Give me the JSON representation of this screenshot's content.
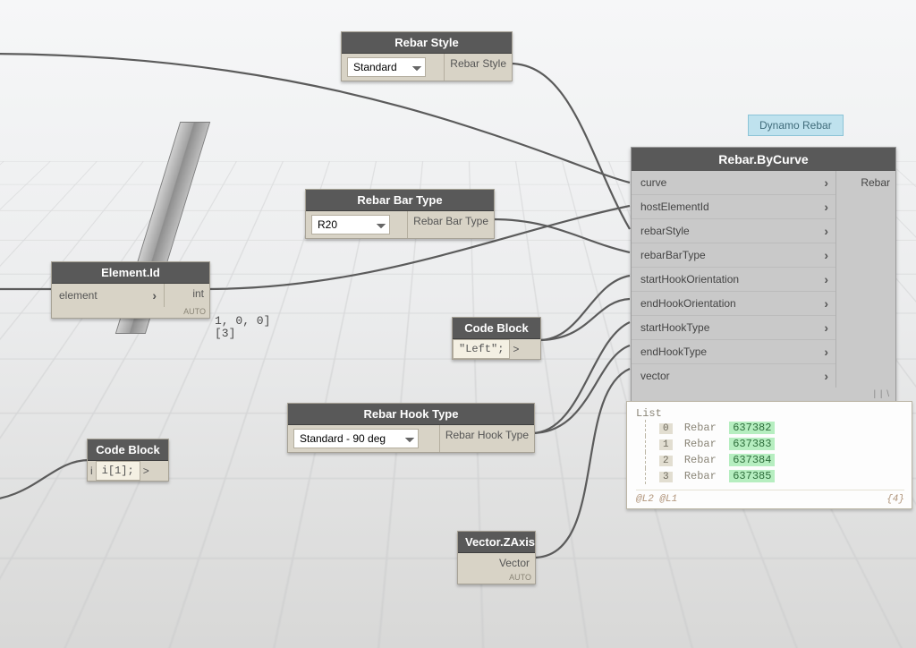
{
  "chip": {
    "label": "Dynamo Rebar"
  },
  "nodes": {
    "rebar_style": {
      "title": "Rebar Style",
      "value": "Standard",
      "out": "Rebar Style"
    },
    "rebar_bar_type": {
      "title": "Rebar Bar Type",
      "value": "R20",
      "out": "Rebar Bar Type"
    },
    "rebar_hook_type": {
      "title": "Rebar Hook Type",
      "value": "Standard - 90 deg",
      "out": "Rebar Hook Type"
    },
    "vector_zaxis": {
      "title": "Vector.ZAxis",
      "out": "Vector",
      "auto": "AUTO"
    },
    "element_id": {
      "title": "Element.Id",
      "in": "element",
      "out": "int",
      "auto": "AUTO"
    },
    "code_block_i": {
      "title": "Code Block",
      "code": "i[1];",
      "ports": [
        "i",
        ">"
      ]
    },
    "code_block_left": {
      "title": "Code Block",
      "code": "\"Left\";",
      "ports": [
        ">"
      ]
    }
  },
  "bignode": {
    "title": "Rebar.ByCurve",
    "out": "Rebar",
    "inputs": [
      "curve",
      "hostElementId",
      "rebarStyle",
      "rebarBarType",
      "startHookOrientation",
      "endHookOrientation",
      "startHookType",
      "endHookType",
      "vector"
    ],
    "lacing": "| | \\"
  },
  "preview": {
    "header": "List",
    "rows": [
      {
        "idx": "0",
        "type": "Rebar",
        "value": "637382"
      },
      {
        "idx": "1",
        "type": "Rebar",
        "value": "637383"
      },
      {
        "idx": "2",
        "type": "Rebar",
        "value": "637384"
      },
      {
        "idx": "3",
        "type": "Rebar",
        "value": "637385"
      }
    ],
    "levels": "@L2 @L1",
    "count": "{4}"
  },
  "floor_overlay": {
    "line1": "1, 0, 0]",
    "line2": "[3]"
  },
  "chart_data": {
    "type": "diagram",
    "title": "Dynamo visual-programming graph — Rebar.ByCurve",
    "nodes": [
      {
        "id": "rebar_style",
        "label": "Rebar Style",
        "outputs": [
          "Rebar Style"
        ],
        "value": "Standard"
      },
      {
        "id": "rebar_bar_type",
        "label": "Rebar Bar Type",
        "outputs": [
          "Rebar Bar Type"
        ],
        "value": "R20"
      },
      {
        "id": "rebar_hook_type",
        "label": "Rebar Hook Type",
        "outputs": [
          "Rebar Hook Type"
        ],
        "value": "Standard - 90 deg"
      },
      {
        "id": "element_id",
        "label": "Element.Id",
        "inputs": [
          "element"
        ],
        "outputs": [
          "int"
        ]
      },
      {
        "id": "code_block_i",
        "label": "Code Block",
        "code": "i[1];"
      },
      {
        "id": "code_block_left",
        "label": "Code Block",
        "code": "\"Left\";"
      },
      {
        "id": "vector_zaxis",
        "label": "Vector.ZAxis",
        "outputs": [
          "Vector"
        ]
      },
      {
        "id": "rebar_by_curve",
        "label": "Rebar.ByCurve",
        "inputs": [
          "curve",
          "hostElementId",
          "rebarStyle",
          "rebarBarType",
          "startHookOrientation",
          "endHookOrientation",
          "startHookType",
          "endHookType",
          "vector"
        ],
        "outputs": [
          "Rebar"
        ]
      }
    ],
    "edges": [
      {
        "from": "rebar_style",
        "to": "rebar_by_curve",
        "to_port": "rebarStyle"
      },
      {
        "from": "rebar_bar_type",
        "to": "rebar_by_curve",
        "to_port": "rebarBarType"
      },
      {
        "from": "element_id",
        "to": "rebar_by_curve",
        "to_port": "hostElementId"
      },
      {
        "from": "code_block_left",
        "to": "rebar_by_curve",
        "to_port": "startHookOrientation"
      },
      {
        "from": "code_block_left",
        "to": "rebar_by_curve",
        "to_port": "endHookOrientation"
      },
      {
        "from": "rebar_hook_type",
        "to": "rebar_by_curve",
        "to_port": "startHookType"
      },
      {
        "from": "rebar_hook_type",
        "to": "rebar_by_curve",
        "to_port": "endHookType"
      },
      {
        "from": "vector_zaxis",
        "to": "rebar_by_curve",
        "to_port": "vector"
      },
      {
        "from": "offscreen_left",
        "to": "element_id",
        "to_port": "element"
      },
      {
        "from": "offscreen_left",
        "to": "code_block_i",
        "to_port": "i"
      },
      {
        "from": "offscreen_left",
        "to": "rebar_by_curve",
        "to_port": "curve"
      }
    ]
  }
}
